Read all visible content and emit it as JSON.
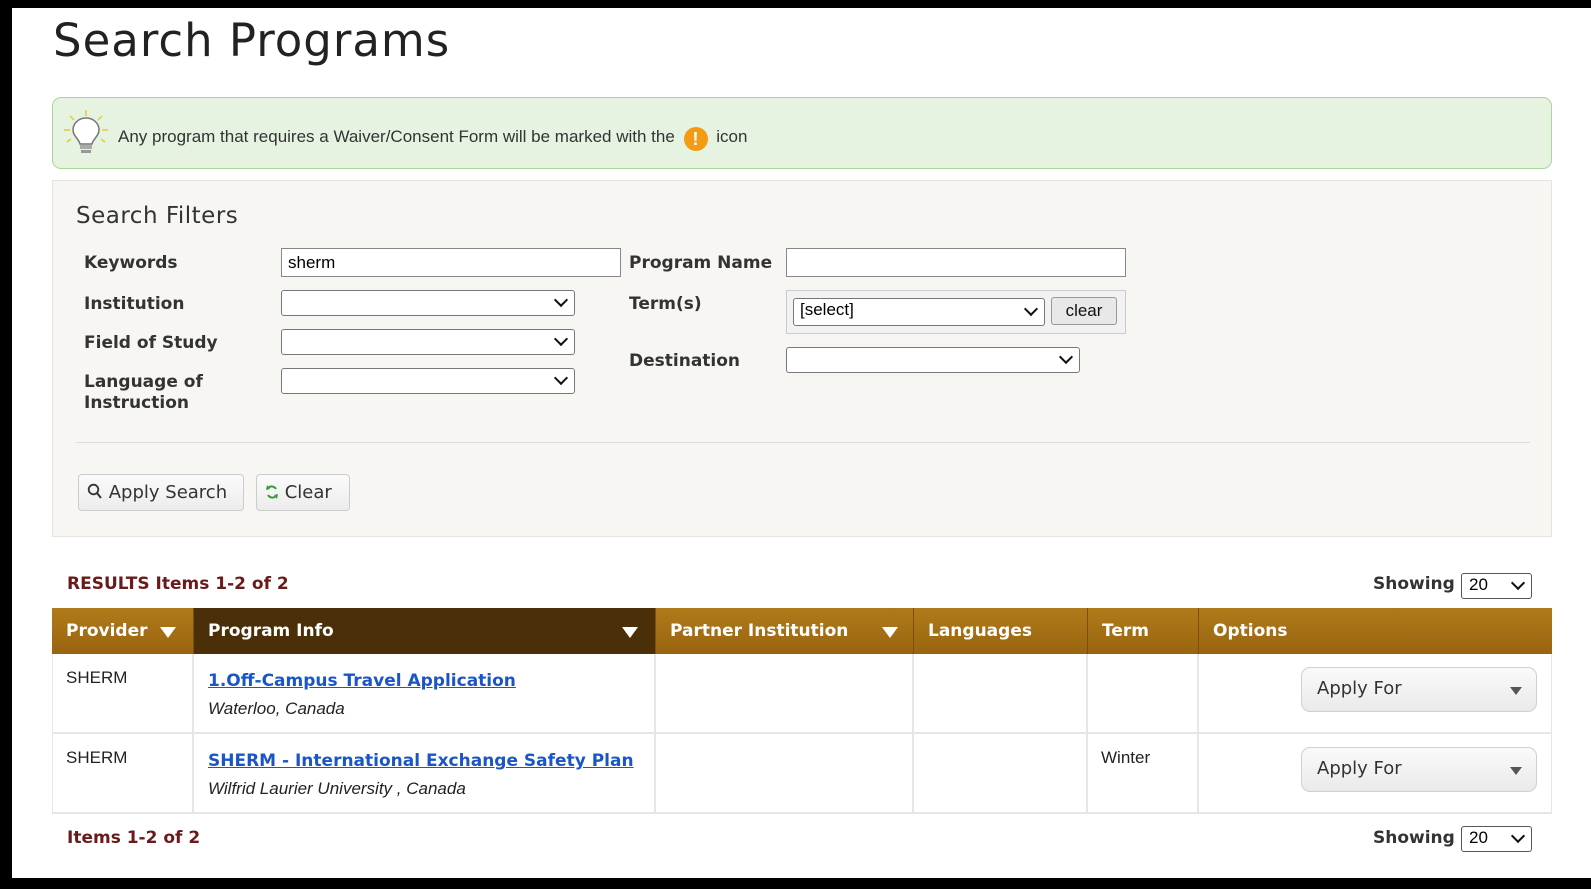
{
  "page": {
    "title": "Search Programs"
  },
  "notice": {
    "text_before": "Any program that requires a Waiver/Consent Form will be marked with the",
    "text_after": "icon",
    "icon_glyph": "!",
    "icon_color": "#f39b13"
  },
  "filters": {
    "heading": "Search Filters",
    "keywords": {
      "label": "Keywords",
      "value": "sherm"
    },
    "program_name": {
      "label": "Program Name",
      "value": ""
    },
    "institution": {
      "label": "Institution",
      "value": ""
    },
    "terms": {
      "label": "Term(s)",
      "value": "[select]",
      "clear_label": "clear"
    },
    "field_of_study": {
      "label": "Field of Study",
      "value": ""
    },
    "destination": {
      "label": "Destination",
      "value": ""
    },
    "language": {
      "label_line1": "Language of",
      "label_line2": "Instruction",
      "value": ""
    },
    "apply_label": "Apply Search",
    "clear_label": "Clear"
  },
  "results": {
    "summary": "RESULTS Items 1-2 of 2",
    "footer_summary": "Items 1-2 of 2",
    "showing_label": "Showing",
    "page_size": "20",
    "columns": [
      "Provider",
      "Program Info",
      "Partner Institution",
      "Languages",
      "Term",
      "Options"
    ],
    "rows": [
      {
        "provider": "SHERM",
        "program": "1.Off-Campus Travel Application",
        "location": "Waterloo, Canada",
        "partner": "",
        "languages": "",
        "term": "",
        "action": "Apply For"
      },
      {
        "provider": "SHERM",
        "program": "SHERM - International Exchange Safety Plan",
        "location": "Wilfrid Laurier University , Canada",
        "partner": "",
        "languages": "",
        "term": "Winter",
        "action": "Apply For"
      }
    ]
  },
  "colors": {
    "header_bar": "#9a6410",
    "header_sorted": "#4a2f08",
    "results_text": "#6b1a1a",
    "link": "#1a56c8",
    "notice_bg": "#e6f3e0"
  }
}
